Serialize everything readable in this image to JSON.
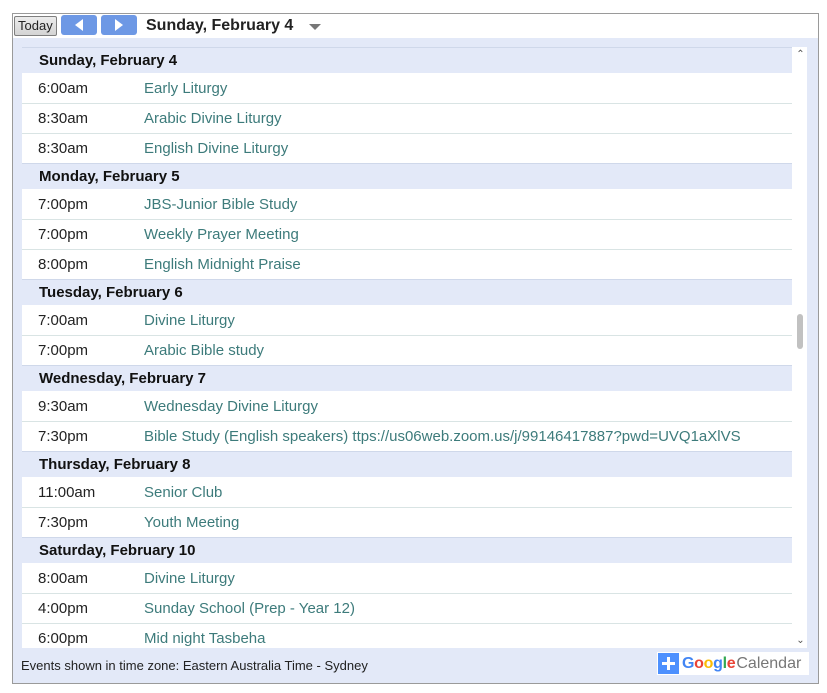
{
  "toolbar": {
    "today_label": "Today",
    "current_date": "Sunday, February 4"
  },
  "colors": {
    "nav_button": "#6d98e5",
    "day_header_bg": "#e3e9f8",
    "event_title": "#3d7b7b"
  },
  "agenda": [
    {
      "day": "Sunday, February 4",
      "events": [
        {
          "time": "6:00am",
          "title": "Early Liturgy"
        },
        {
          "time": "8:30am",
          "title": "Arabic Divine Liturgy"
        },
        {
          "time": "8:30am",
          "title": "English Divine Liturgy"
        }
      ]
    },
    {
      "day": "Monday, February 5",
      "events": [
        {
          "time": "7:00pm",
          "title": "JBS-Junior Bible Study"
        },
        {
          "time": "7:00pm",
          "title": "Weekly Prayer Meeting"
        },
        {
          "time": "8:00pm",
          "title": "English Midnight Praise"
        }
      ]
    },
    {
      "day": "Tuesday, February 6",
      "events": [
        {
          "time": "7:00am",
          "title": "Divine Liturgy"
        },
        {
          "time": "7:00pm",
          "title": "Arabic Bible study"
        }
      ]
    },
    {
      "day": "Wednesday, February 7",
      "events": [
        {
          "time": "9:30am",
          "title": "Wednesday Divine Liturgy"
        },
        {
          "time": "7:30pm",
          "title": "Bible Study (English speakers) ttps://us06web.zoom.us/j/99146417887?pwd=UVQ1aXlVS"
        }
      ]
    },
    {
      "day": "Thursday, February 8",
      "events": [
        {
          "time": "11:00am",
          "title": "Senior Club"
        },
        {
          "time": "7:30pm",
          "title": "Youth Meeting"
        }
      ]
    },
    {
      "day": "Saturday, February 10",
      "events": [
        {
          "time": "8:00am",
          "title": "Divine Liturgy"
        },
        {
          "time": "4:00pm",
          "title": "Sunday School (Prep - Year 12)"
        },
        {
          "time": "6:00pm",
          "title": "Mid night Tasbeha"
        }
      ]
    }
  ],
  "footer": {
    "timezone_text": "Events shown in time zone: Eastern Australia Time - Sydney",
    "badge_google": "Google",
    "badge_calendar": "Calendar"
  }
}
